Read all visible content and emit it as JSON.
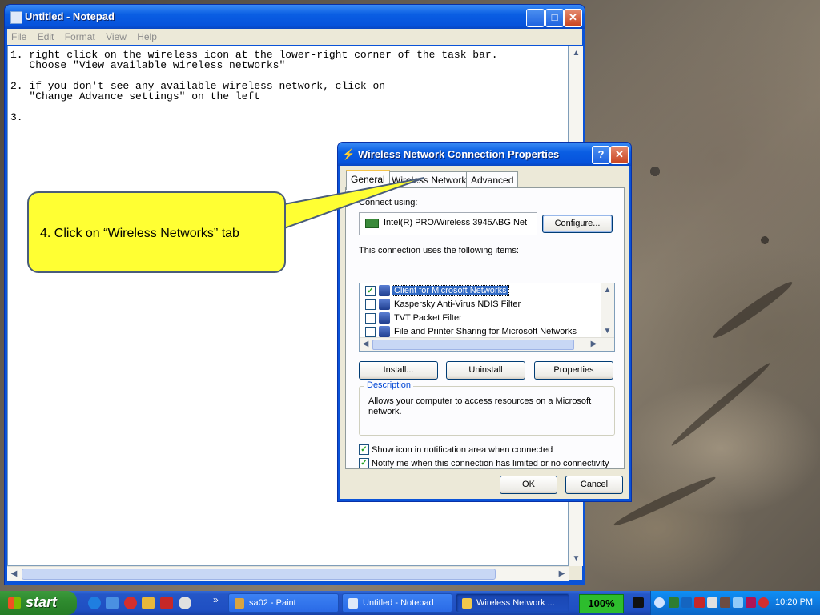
{
  "notepad": {
    "title": "Untitled - Notepad",
    "menu": [
      "File",
      "Edit",
      "Format",
      "View",
      "Help"
    ],
    "content": "1. right click on the wireless icon at the lower-right corner of the task bar.\n   Choose \"View available wireless networks\"\n\n2. if you don't see any available wireless network, click on\n   \"Change Advance settings\" on the left\n\n3."
  },
  "dialog": {
    "title": "Wireless Network Connection Properties",
    "help_btn": "?",
    "close_btn": "✕",
    "tabs": [
      "General",
      "Wireless Networks",
      "Advanced"
    ],
    "connect_using_label": "Connect using:",
    "adapter_name": "Intel(R) PRO/Wireless 3945ABG Net",
    "configure_btn": "Configure...",
    "items_label": "This connection uses the following items:",
    "items": [
      {
        "label": "Client for Microsoft Networks",
        "checked": true
      },
      {
        "label": "Kaspersky Anti-Virus NDIS Filter",
        "checked": false
      },
      {
        "label": "TVT Packet Filter",
        "checked": false
      },
      {
        "label": "File and Printer Sharing for Microsoft Networks",
        "checked": false
      }
    ],
    "install_btn": "Install...",
    "uninstall_btn": "Uninstall",
    "properties_btn": "Properties",
    "description_legend": "Description",
    "description_text": "Allows your computer to access resources on a Microsoft network.",
    "show_icon_label": "Show icon in notification area when connected",
    "notify_label": "Notify me when this connection has limited or no connectivity",
    "ok_btn": "OK",
    "cancel_btn": "Cancel"
  },
  "callout": {
    "text": "4. Click on “Wireless Networks” tab"
  },
  "taskbar": {
    "start_label": "start",
    "chevron": "»",
    "buttons": [
      {
        "label": "sa02 - Paint",
        "icon": "paint-icon"
      },
      {
        "label": "Untitled - Notepad",
        "icon": "notepad-icon"
      },
      {
        "label": "Wireless Network ...",
        "icon": "network-icon"
      }
    ],
    "battery": "100%",
    "clock": "10:20 PM"
  },
  "colors": {
    "xp_blue": "#0a53d8",
    "callout_yellow": "#ffff33",
    "dialog_face": "#ece9d8",
    "start_green": "#2f8b2f"
  }
}
